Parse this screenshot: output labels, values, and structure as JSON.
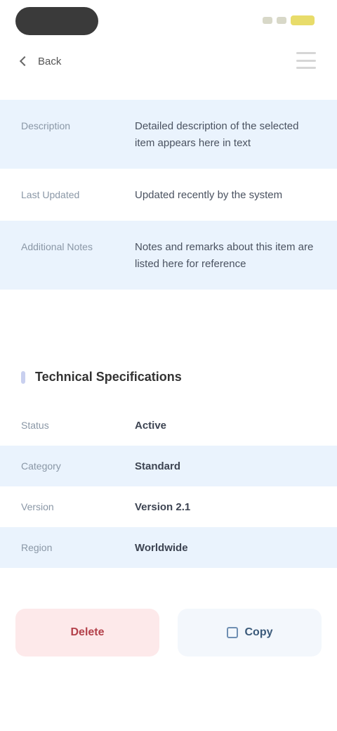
{
  "nav": {
    "back_label": "Back",
    "icons": {
      "back": "chevron-left-icon",
      "menu": "menu-icon"
    }
  },
  "details": [
    {
      "label": "Description",
      "value": "Detailed description of the selected item appears here in text"
    },
    {
      "label": "Last Updated",
      "value": "Updated recently by the system"
    },
    {
      "label": "Additional Notes",
      "value": "Notes and remarks about this item are listed here for reference"
    }
  ],
  "section": {
    "title": "Technical Specifications"
  },
  "specs": [
    {
      "label": "Status",
      "value": "Active"
    },
    {
      "label": "Category",
      "value": "Standard"
    },
    {
      "label": "Version",
      "value": "Version 2.1"
    },
    {
      "label": "Region",
      "value": "Worldwide"
    }
  ],
  "actions": {
    "delete_label": "Delete",
    "copy_label": "Copy",
    "icons": {
      "copy": "copy-icon"
    }
  },
  "colors": {
    "accent_row": "#eaf3fd",
    "danger_bg": "#fde9ea",
    "danger_text": "#b3404a"
  }
}
